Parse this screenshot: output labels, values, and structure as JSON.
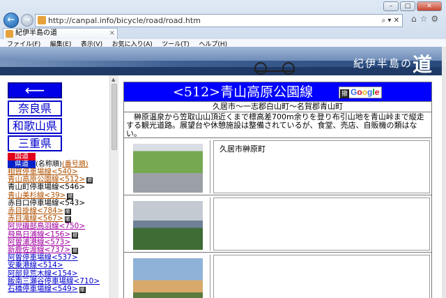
{
  "browser": {
    "address": "http://canpal.info/bicycle/road/road.htm",
    "tab_title": "紀伊半島の道",
    "menu": [
      "ファイル(F)",
      "編集(E)",
      "表示(V)",
      "お気に入り(A)",
      "ツール(T)",
      "ヘルプ(H)"
    ]
  },
  "banner": {
    "title_small": "紀伊半島の",
    "title_big": "道"
  },
  "sidebar": {
    "back_label": "⟵",
    "prefectures": [
      "奈良県",
      "和歌山県",
      "三重県"
    ],
    "legend": {
      "kokudo": "国道",
      "kendo": "県道",
      "by_name": "(名称順)",
      "by_number": "(番号順)"
    },
    "routes": [
      {
        "text": "相賀停車場線<540>",
        "style": "l1",
        "badge": false
      },
      {
        "text": "青山高原公園線<512>",
        "style": "l1",
        "badge": true
      },
      {
        "text": "青山町停車場線<546>",
        "style": "plain",
        "badge": false
      },
      {
        "text": "青山美杉線<39>",
        "style": "l1",
        "badge": true
      },
      {
        "text": "赤目口停車場線<543>",
        "style": "plain",
        "badge": false
      },
      {
        "text": "赤目掛線<784>",
        "style": "l1",
        "badge": true
      },
      {
        "text": "赤目滝線<567>",
        "style": "l1",
        "badge": true
      },
      {
        "text": "阿児磯部鳥羽線<750>",
        "style": "l2",
        "badge": false
      },
      {
        "text": "飛鳥日浦線<156>",
        "style": "l2",
        "badge": true
      },
      {
        "text": "阿曽浦港線<573>",
        "style": "l2",
        "badge": false
      },
      {
        "text": "新鹿佐渡線<737>",
        "style": "l2",
        "badge": true
      },
      {
        "text": "阿曽停車場線<537>",
        "style": "l3",
        "badge": false
      },
      {
        "text": "安乗港線<514>",
        "style": "l3",
        "badge": false
      },
      {
        "text": "阿部見荒木線<154>",
        "style": "l3",
        "badge": false
      },
      {
        "text": "飯南三瀬谷停車場線<710>",
        "style": "l3",
        "badge": false
      },
      {
        "text": "石橋停車場線<549>",
        "style": "l3",
        "badge": true
      }
    ]
  },
  "content": {
    "title": "<512>青山高原公園線",
    "google_badge": "Google",
    "google_kanji": "撤",
    "subtitle": "久居市～一志郡白山町～名賀郡青山町",
    "description": "　榊原温泉から笠取山山頂近くまで標高差700m余りを登り布引山地を青山峠まで縦走する観光道路。展望台や休憩施設は整備されているが、食堂、売店、自販機の類はない。",
    "photos": [
      {
        "caption": "久居市榊原町"
      },
      {
        "caption": ""
      },
      {
        "caption": ""
      }
    ]
  }
}
